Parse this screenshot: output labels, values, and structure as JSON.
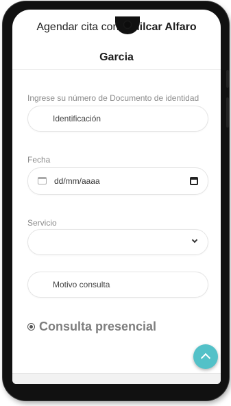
{
  "header": {
    "title_prefix": "Agendar cita con ",
    "doctor_name_line1": "Amilcar Alfaro",
    "doctor_name_line2": "Garcia"
  },
  "form": {
    "document_label": "Ingrese su número de Documento de identidad",
    "document_placeholder": "Identificación",
    "date_label": "Fecha",
    "date_placeholder": "dd/mm/aaaa",
    "service_label": "Servicio",
    "service_selected": "",
    "reason_placeholder": "Motivo consulta",
    "consult_type_label": "Consulta presencial",
    "consult_type_selected": true
  },
  "icons": {
    "date_field_icon": "calendar-icon",
    "date_picker_icon": "calendar-icon",
    "select_icon": "chevron-down-icon",
    "radio_icon": "radio-checked-icon",
    "fab_icon": "chevron-up-icon"
  },
  "colors": {
    "fab": "#53c1c8",
    "label": "#8a8a8a",
    "radio_label": "#7e7e7e"
  }
}
